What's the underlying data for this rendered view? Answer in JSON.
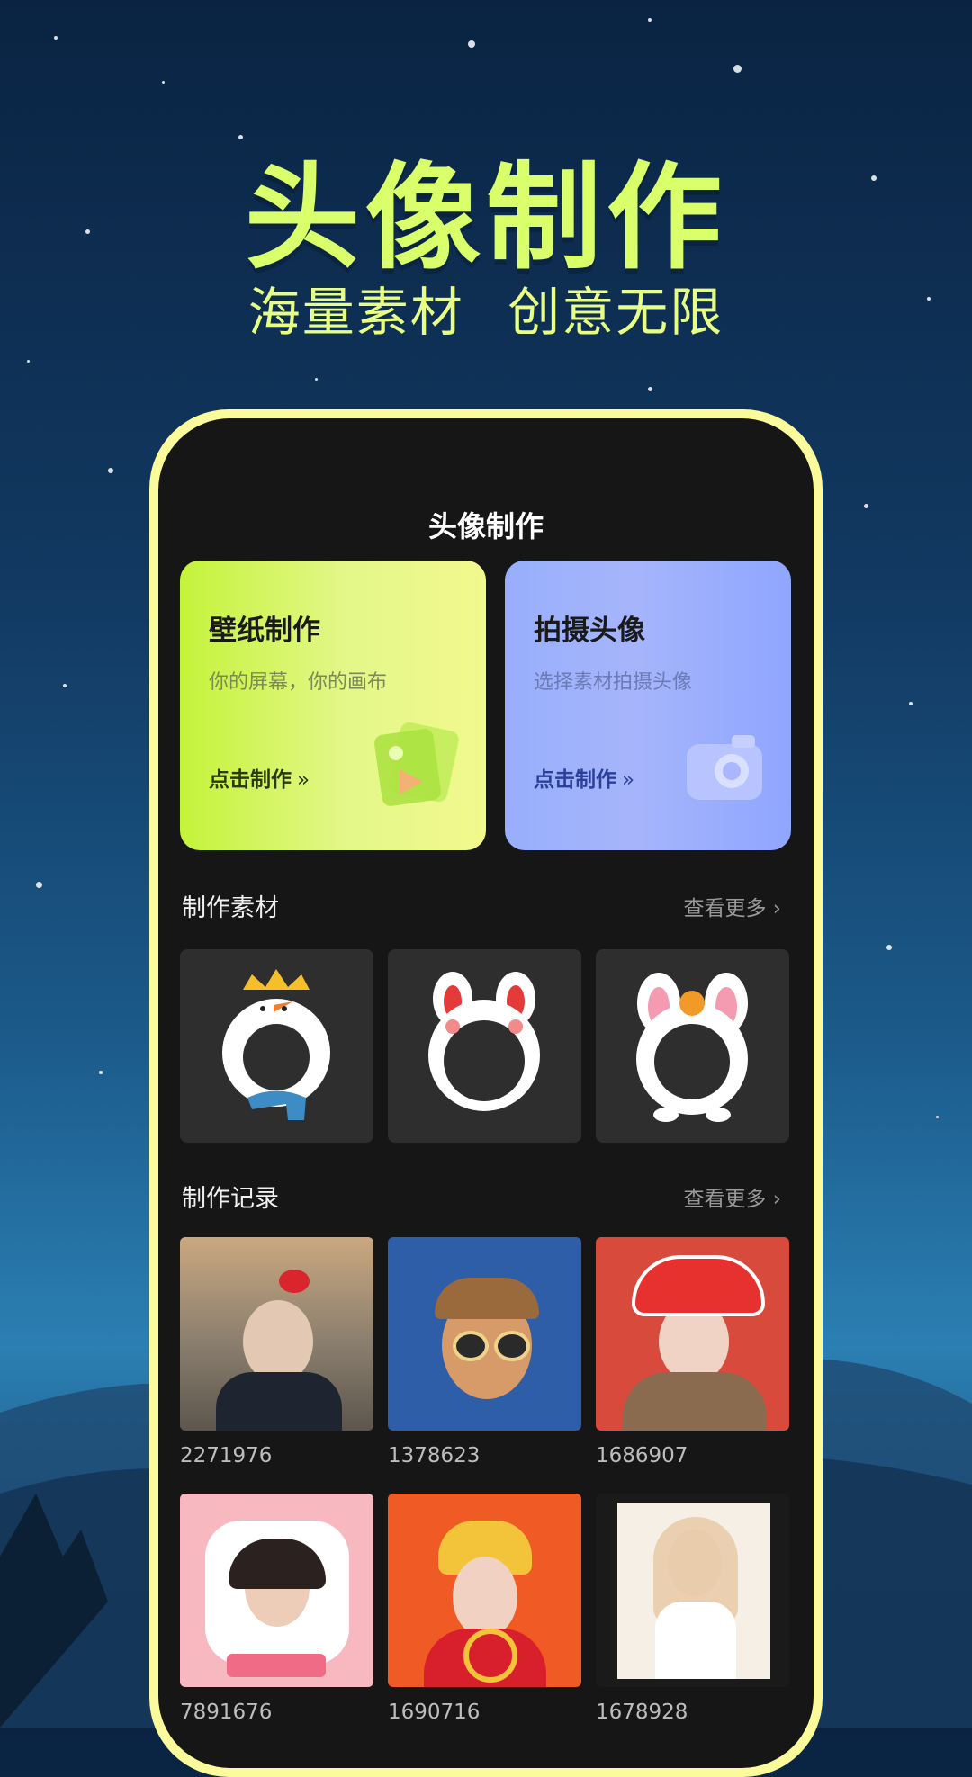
{
  "promo": {
    "headline": "头像制作",
    "subline": "海量素材 创意无限"
  },
  "screen": {
    "title": "头像制作"
  },
  "cards": [
    {
      "title": "壁纸制作",
      "subtitle": "你的屏幕，你的画布",
      "cta": "点击制作",
      "icon": "picture-cards-icon"
    },
    {
      "title": "拍摄头像",
      "subtitle": "选择素材拍摄头像",
      "cta": "点击制作",
      "icon": "camera-icon"
    }
  ],
  "materials": {
    "title": "制作素材",
    "more": "查看更多",
    "items": [
      "snowman-frame",
      "red-bunny-frame",
      "orange-bunny-frame"
    ]
  },
  "records": {
    "title": "制作记录",
    "more": "查看更多",
    "items": [
      {
        "id": "2271976"
      },
      {
        "id": "1378623"
      },
      {
        "id": "1686907"
      },
      {
        "id": "7891676"
      },
      {
        "id": "1690716"
      },
      {
        "id": "1678928"
      }
    ]
  },
  "colors": {
    "accent_yellow": "#d9ff6a",
    "phone_frame": "#fbfb9c",
    "screen_bg": "#161616",
    "card_yellow": "#c4f33b",
    "card_blue": "#98aefc"
  }
}
